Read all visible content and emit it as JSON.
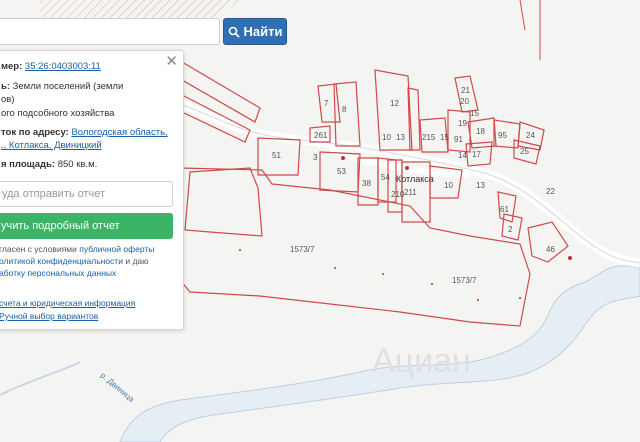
{
  "search": {
    "button_label": "Найти",
    "icon": "search-icon",
    "accent": "#2f6fb3"
  },
  "panel": {
    "number_label": "мер:",
    "number_value": "35:26:0403003:11",
    "category_label": "ь:",
    "category_value_1": "Земли поселений (земли",
    "category_value_2": "ов)",
    "usage_value": "ого подсобного хозяйства",
    "address_label": "ток по адресу:",
    "address_link_1": "Вологодская область,",
    "address_link_2": "., Котлакса, Двиницкий",
    "area_label": "я площадь:",
    "area_value": "850 кв.м.",
    "email_placeholder": "уда отправить отчет",
    "report_button": "учить подробный отчет",
    "agree_text_1": "гласен с условиями",
    "agree_link_1": "публичной оферты",
    "agree_text_2": "олитикой конфиденциальности",
    "agree_text_3": "и даю",
    "agree_link_3": "аботку персональных данных",
    "link_requisites": "счета и юридическая информация",
    "link_manual": "Ручной выбор вариантов",
    "report_color": "#3bb465"
  },
  "map": {
    "village": "Котлакса",
    "river": "р. Двиница",
    "watermark": "Ациан",
    "parcel_labels": [
      "7",
      "8",
      "12",
      "21",
      "20",
      "261",
      "51",
      "3",
      "53",
      "38",
      "54",
      "210",
      "211",
      "10",
      "13",
      "215",
      "15",
      "91",
      "19",
      "14",
      "18",
      "95",
      "24",
      "25",
      "17",
      "10",
      "13",
      "15",
      "22",
      "61",
      "2",
      "46",
      "1573/7",
      "1573/7"
    ]
  }
}
